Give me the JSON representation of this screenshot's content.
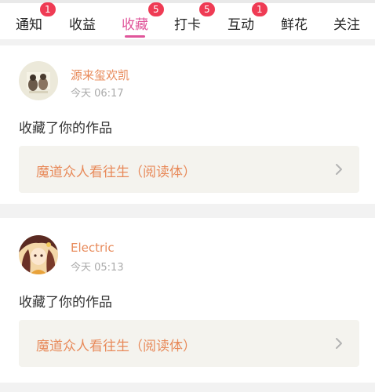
{
  "tabs": [
    {
      "label": "通知",
      "badge": "1"
    },
    {
      "label": "收益",
      "badge": ""
    },
    {
      "label": "收藏",
      "badge": "5"
    },
    {
      "label": "打卡",
      "badge": "5"
    },
    {
      "label": "互动",
      "badge": "1"
    },
    {
      "label": "鲜花",
      "badge": ""
    },
    {
      "label": "关注",
      "badge": ""
    }
  ],
  "active_tab": "收藏",
  "notifications": [
    {
      "username": "源来玺欢凯",
      "time": "今天 06:17",
      "action": "收藏了你的作品",
      "work_title": "魔道众人看往生（阅读体）"
    },
    {
      "username": "Electric",
      "time": "今天 05:13",
      "action": "收藏了你的作品",
      "work_title": "魔道众人看往生（阅读体）"
    }
  ],
  "colors": {
    "accent": "#e0559a",
    "badge": "#ef3b54",
    "name": "#e88a5a",
    "work_bg": "#f4f3ee"
  },
  "icons": {
    "chevron": "chevron-right-icon"
  }
}
